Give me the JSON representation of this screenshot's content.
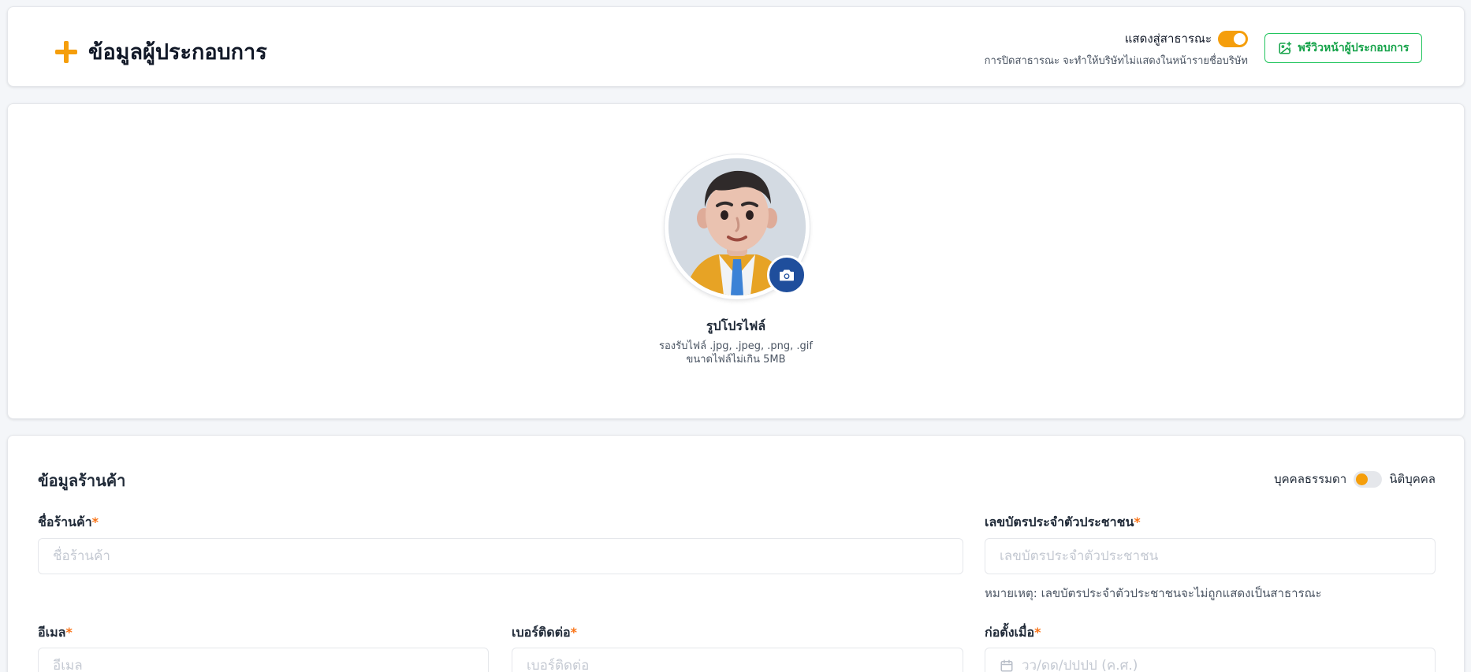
{
  "header": {
    "title": "ข้อมูลผู้ประกอบการ",
    "public_label": "แสดงสู่สาธารณะ",
    "public_enabled": true,
    "public_note": "การปิดสาธารณะ จะทำให้บริษัทไม่แสดงในหน้ารายชื่อบริษัท",
    "preview_button": "พรีวิวหน้าผู้ประกอบการ"
  },
  "profile": {
    "title": "รูปโปรไฟล์",
    "formats": "รองรับไฟล์ .jpg, .jpeg, .png, .gif",
    "size_limit": "ขนาดไฟล์ไม่เกิน 5MB"
  },
  "store": {
    "section_title": "ข้อมูลร้านค้า",
    "entity_left": "บุคคลธรรมดา",
    "entity_right": "นิติบุคคล",
    "entity_selected": "บุคคลธรรมดา",
    "required_mark": "*",
    "fields": {
      "store_name": {
        "label": "ชื่อร้านค้า",
        "placeholder": "ชื่อร้านค้า",
        "value": ""
      },
      "id_card": {
        "label": "เลขบัตรประจำตัวประชาชน",
        "placeholder": "เลขบัตรประจำตัวประชาชน",
        "value": "",
        "note": "หมายเหตุ: เลขบัตรประจำตัวประชาชนจะไม่ถูกแสดงเป็นสาธารณะ"
      },
      "email": {
        "label": "อีเมล",
        "placeholder": "อีเมล",
        "value": ""
      },
      "phone": {
        "label": "เบอร์ติดต่อ",
        "placeholder": "เบอร์ติดต่อ",
        "value": ""
      },
      "established": {
        "label": "ก่อตั้งเมื่อ",
        "placeholder": "วว/ดด/ปปปป (ค.ศ.)",
        "value": ""
      }
    }
  },
  "colors": {
    "accent": "#f59e0b",
    "green": "#22c55e",
    "camera": "#1f4e9c",
    "required": "#f97316"
  }
}
